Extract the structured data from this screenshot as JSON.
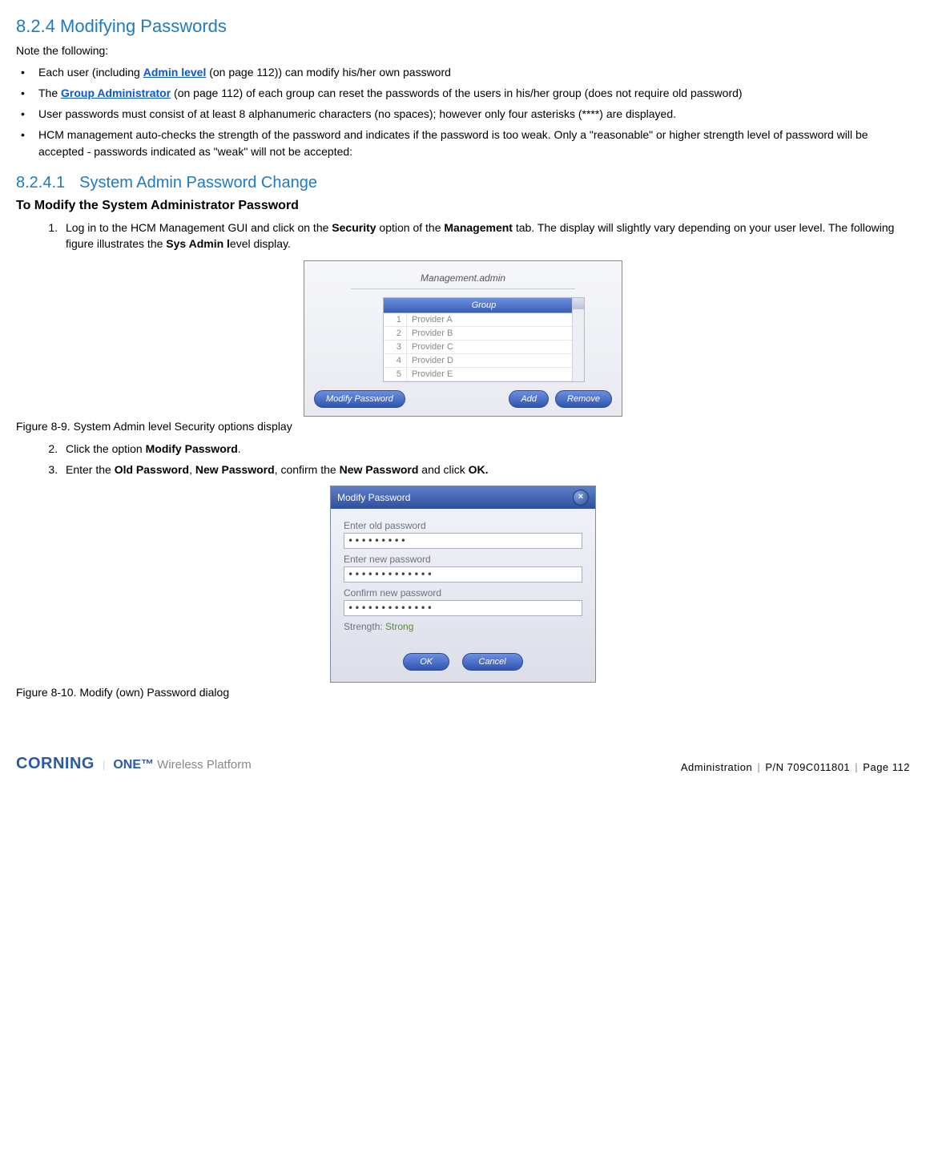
{
  "headings": {
    "sec": "8.2.4 Modifying Passwords",
    "subsec_num": "8.2.4.1",
    "subsec_title": "System Admin Password Change",
    "subhead": "To Modify the System Administrator Password"
  },
  "intro": "Note the following:",
  "bullets": {
    "b1a": "Each user (including ",
    "b1_link": "Admin level",
    "b1b": " (on page 112)) can modify his/her own password",
    "b2a": "The ",
    "b2_link": "Group Administrator",
    "b2b": " (on page 112) of each group can reset the passwords of the users in his/her group (does not require old password)",
    "b3": "User passwords must consist of at least 8 alphanumeric characters (no spaces); however only four asterisks (****) are displayed.",
    "b4": "HCM management auto-checks the strength of the password and indicates if the password is too weak. Only a \"reasonable\" or higher strength level of password will be accepted - passwords indicated as \"weak\" will not be accepted:"
  },
  "steps": {
    "s1a": "Log in to the HCM Management GUI and click on the ",
    "s1b": "Security",
    "s1c": " option of the ",
    "s1d": "Management",
    "s1e": " tab. The display will slightly vary depending on your user level. The following figure illustrates the ",
    "s1f": "Sys Admin l",
    "s1g": "evel display.",
    "s2a": "Click the option ",
    "s2b": "Modify Password",
    "s2c": ".",
    "s3a": "Enter the ",
    "s3b": "Old Password",
    "s3c": ", ",
    "s3d": "New Password",
    "s3e": ", confirm the ",
    "s3f": "New Password",
    "s3g": " and click ",
    "s3h": "OK."
  },
  "fig1": {
    "caption": "Figure 8-9. System Admin level Security options display",
    "title": "Management.admin",
    "group_header": "Group",
    "rows": [
      {
        "n": "1",
        "t": "Provider A"
      },
      {
        "n": "2",
        "t": "Provider B"
      },
      {
        "n": "3",
        "t": "Provider C"
      },
      {
        "n": "4",
        "t": "Provider D"
      },
      {
        "n": "5",
        "t": "Provider E"
      }
    ],
    "btn_modify": "Modify Password",
    "btn_add": "Add",
    "btn_remove": "Remove"
  },
  "fig2": {
    "caption": "Figure 8-10. Modify (own) Password dialog",
    "title": "Modify Password",
    "lbl_old": "Enter old password",
    "val_old": "•••••••••",
    "lbl_new": "Enter new password",
    "val_new": "•••••••••••••",
    "lbl_conf": "Confirm new password",
    "val_conf": "•••••••••••••",
    "strength_lbl": "Strength: ",
    "strength_val": "Strong",
    "btn_ok": "OK",
    "btn_cancel": "Cancel"
  },
  "footer": {
    "brand1": "CORNING",
    "brand2a": "ONE",
    "brand2b": "™",
    "brand2c": " Wireless Platform",
    "section": "Administration",
    "pn": "P/N 709C011801",
    "page": "Page 112"
  }
}
